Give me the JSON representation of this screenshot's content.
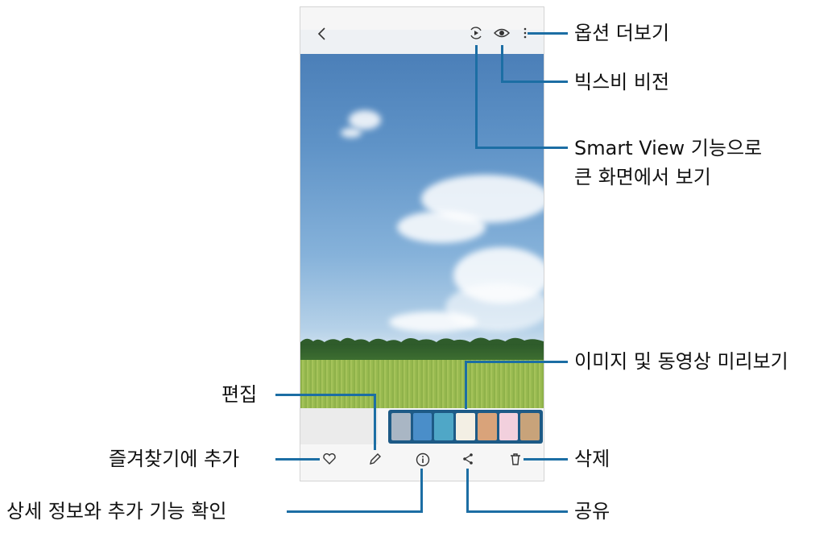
{
  "callouts": {
    "more_options": "옵션 더보기",
    "bixby_vision": "빅스비 비전",
    "smart_view_line1": "Smart View 기능으로",
    "smart_view_line2": "큰 화면에서 보기",
    "preview": "이미지 및 동영상 미리보기",
    "edit": "편집",
    "favorite": "즐겨찾기에 추가",
    "delete": "삭제",
    "details": "상세 정보와 추가 기능 확인",
    "share": "공유"
  },
  "icons": {
    "top": [
      "back-icon",
      "smart-view-icon",
      "eye-icon",
      "more-vert-icon"
    ],
    "bottom": [
      "heart-icon",
      "pencil-icon",
      "info-icon",
      "share-icon",
      "trash-icon"
    ]
  },
  "colors": {
    "callout_line": "#1c6ea4",
    "sky_top": "#4b7fb8",
    "grass": "#98ba50",
    "thumb_strip": "#1d5a86"
  },
  "thumbnail_colors": [
    "#a9b6c4",
    "#4a8ec9",
    "#4fa7c7",
    "#f3efe4",
    "#d9a37a",
    "#f2d0dd",
    "#c8a37a"
  ]
}
